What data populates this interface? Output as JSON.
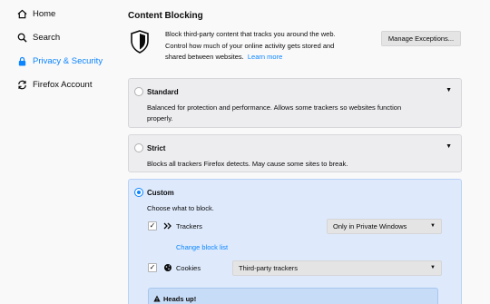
{
  "sidebar": {
    "items": [
      {
        "label": "Home",
        "icon": "home-icon"
      },
      {
        "label": "Search",
        "icon": "search-icon"
      },
      {
        "label": "Privacy & Security",
        "icon": "lock-icon",
        "active": true
      },
      {
        "label": "Firefox Account",
        "icon": "sync-icon"
      }
    ]
  },
  "content_blocking": {
    "title": "Content Blocking",
    "intro_line1": "Block third-party content that tracks you around the web.",
    "intro_line2": "Control how much of your online activity gets stored and",
    "intro_line3": "shared between websites.",
    "learn_more": "Learn more",
    "manage_exceptions": "Manage Exceptions..."
  },
  "options": {
    "standard": {
      "title": "Standard",
      "desc_line1": "Balanced for protection and performance. Allows some trackers so websites function",
      "desc_line2": "properly."
    },
    "strict": {
      "title": "Strict",
      "desc": "Blocks all trackers Firefox detects. May cause some sites to break."
    },
    "custom": {
      "title": "Custom",
      "desc": "Choose what to block.",
      "trackers_label": "Trackers",
      "trackers_select": "Only in Private Windows",
      "change_block_list": "Change block list",
      "cookies_label": "Cookies",
      "cookies_select": "Third-party trackers"
    }
  },
  "heads_up": "Heads up!",
  "colors": {
    "accent": "#0a84ff",
    "selected_card": "#deeafc"
  }
}
